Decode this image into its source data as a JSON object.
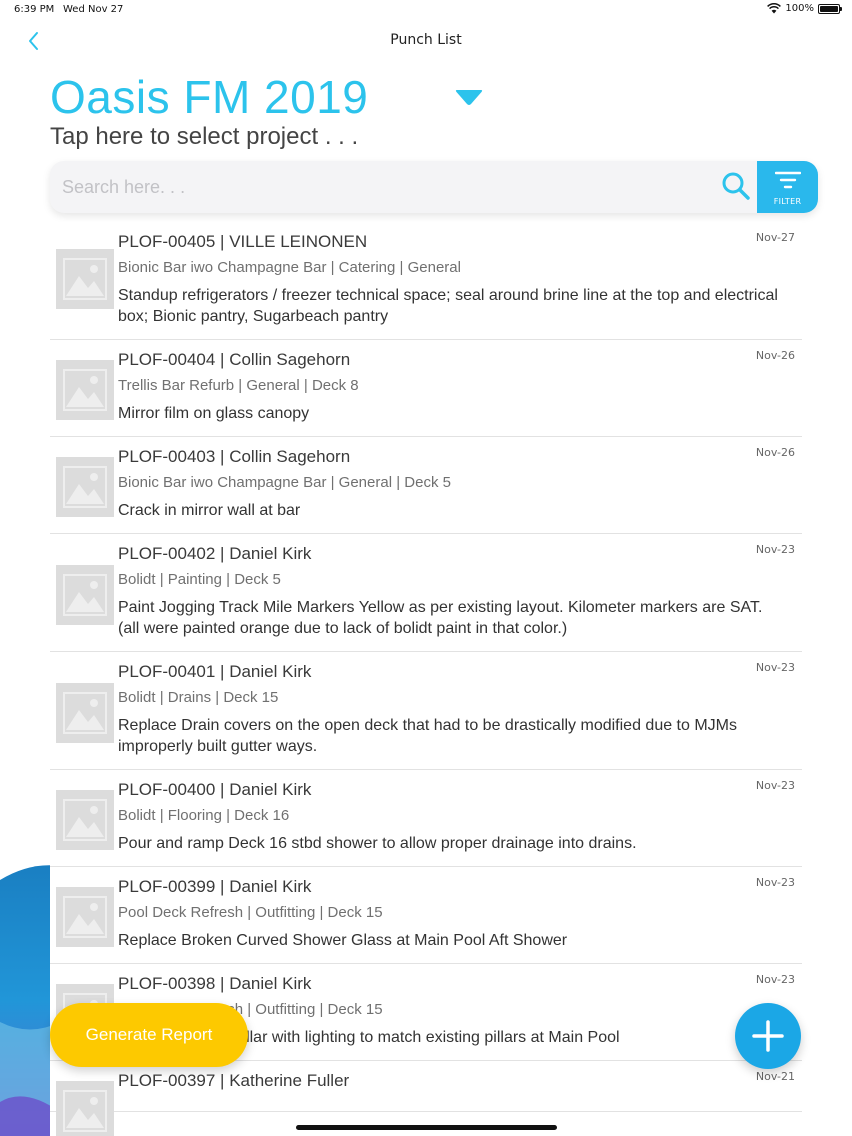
{
  "status_bar": {
    "time": "6:39 PM",
    "date": "Wed Nov 27",
    "battery": "100%"
  },
  "nav": {
    "title": "Punch List"
  },
  "project": {
    "name": "Oasis FM 2019",
    "hint": "Tap here to select project . . ."
  },
  "search": {
    "placeholder": "Search here. . ."
  },
  "filter": {
    "label": "FILTER"
  },
  "items": [
    {
      "title": "PLOF-00405 | VILLE LEINONEN",
      "sub": "Bionic Bar iwo Champagne Bar | Catering | General",
      "desc": "Standup refrigerators / freezer technical space; seal around brine line at the top and electrical box; Bionic pantry, Sugarbeach pantry",
      "date": "Nov-27"
    },
    {
      "title": "PLOF-00404 | Collin Sagehorn",
      "sub": "Trellis Bar Refurb | General | Deck 8",
      "desc": "Mirror film on glass canopy",
      "date": "Nov-26"
    },
    {
      "title": "PLOF-00403 | Collin Sagehorn",
      "sub": "Bionic Bar iwo Champagne Bar | General | Deck 5",
      "desc": "Crack in mirror wall at bar",
      "date": "Nov-26"
    },
    {
      "title": "PLOF-00402 | Daniel Kirk",
      "sub": "Bolidt | Painting | Deck 5",
      "desc": "Paint Jogging Track Mile Markers Yellow as per existing layout. Kilometer markers are SAT. (all were painted orange due to lack of bolidt paint in that color.)",
      "date": "Nov-23"
    },
    {
      "title": "PLOF-00401 | Daniel Kirk",
      "sub": "Bolidt | Drains | Deck 15",
      "desc": "Replace Drain covers on the open deck that had to be drastically modified due to MJMs improperly built gutter ways.",
      "date": "Nov-23"
    },
    {
      "title": "PLOF-00400 | Daniel Kirk",
      "sub": "Bolidt | Flooring | Deck 16",
      "desc": "Pour and ramp Deck 16 stbd shower to allow proper drainage into drains.",
      "date": "Nov-23"
    },
    {
      "title": "PLOF-00399 | Daniel Kirk",
      "sub": "Pool Deck Refresh | Outfitting | Deck 15",
      "desc": "Replace Broken Curved Shower Glass at Main Pool Aft Shower",
      "date": "Nov-23"
    },
    {
      "title": "PLOF-00398 | Daniel Kirk",
      "sub": "Pool Deck Refresh | Outfitting | Deck 15",
      "desc": "Enclose Center Pillar with lighting to match existing pillars at Main Pool",
      "date": "Nov-23"
    },
    {
      "title": "PLOF-00397 | Katherine Fuller",
      "sub": "",
      "desc": "",
      "date": "Nov-21"
    }
  ],
  "actions": {
    "generate_report": "Generate Report"
  },
  "colors": {
    "accent": "#2cc3ec",
    "filter": "#2ab8ec",
    "report": "#fdc900",
    "add": "#1ba7e6"
  }
}
